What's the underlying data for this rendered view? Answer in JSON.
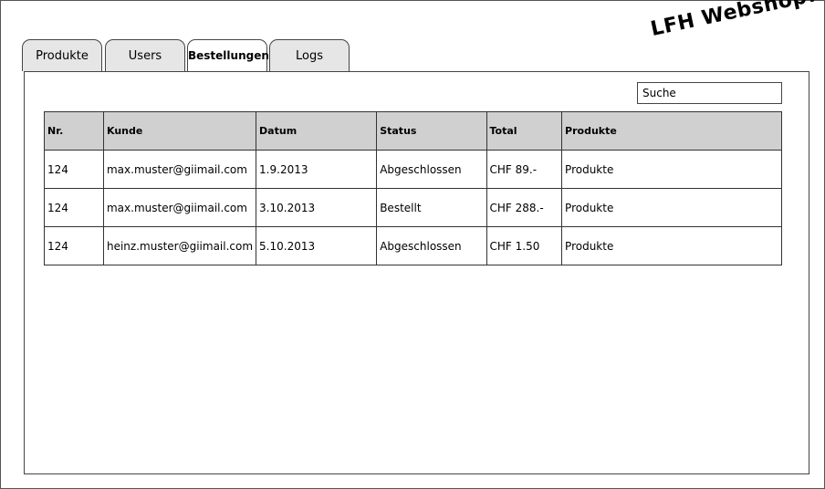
{
  "app": {
    "title": "LFH Webshop!"
  },
  "tabs": [
    {
      "label": "Produkte"
    },
    {
      "label": "Users"
    },
    {
      "label": "Bestellungen"
    },
    {
      "label": "Logs"
    }
  ],
  "search": {
    "placeholder": "Suche"
  },
  "table": {
    "headers": [
      "Nr.",
      "Kunde",
      "Datum",
      "Status",
      "Total",
      "Produkte"
    ],
    "rows": [
      [
        "124",
        "max.muster@giimail.com",
        "1.9.2013",
        "Abgeschlossen",
        "CHF 89.-",
        "Produkte"
      ],
      [
        "124",
        "max.muster@giimail.com",
        "3.10.2013",
        "Bestellt",
        "CHF 288.-",
        "Produkte"
      ],
      [
        "124",
        "heinz.muster@giimail.com",
        "5.10.2013",
        "Abgeschlossen",
        "CHF 1.50",
        "Produkte"
      ]
    ]
  }
}
